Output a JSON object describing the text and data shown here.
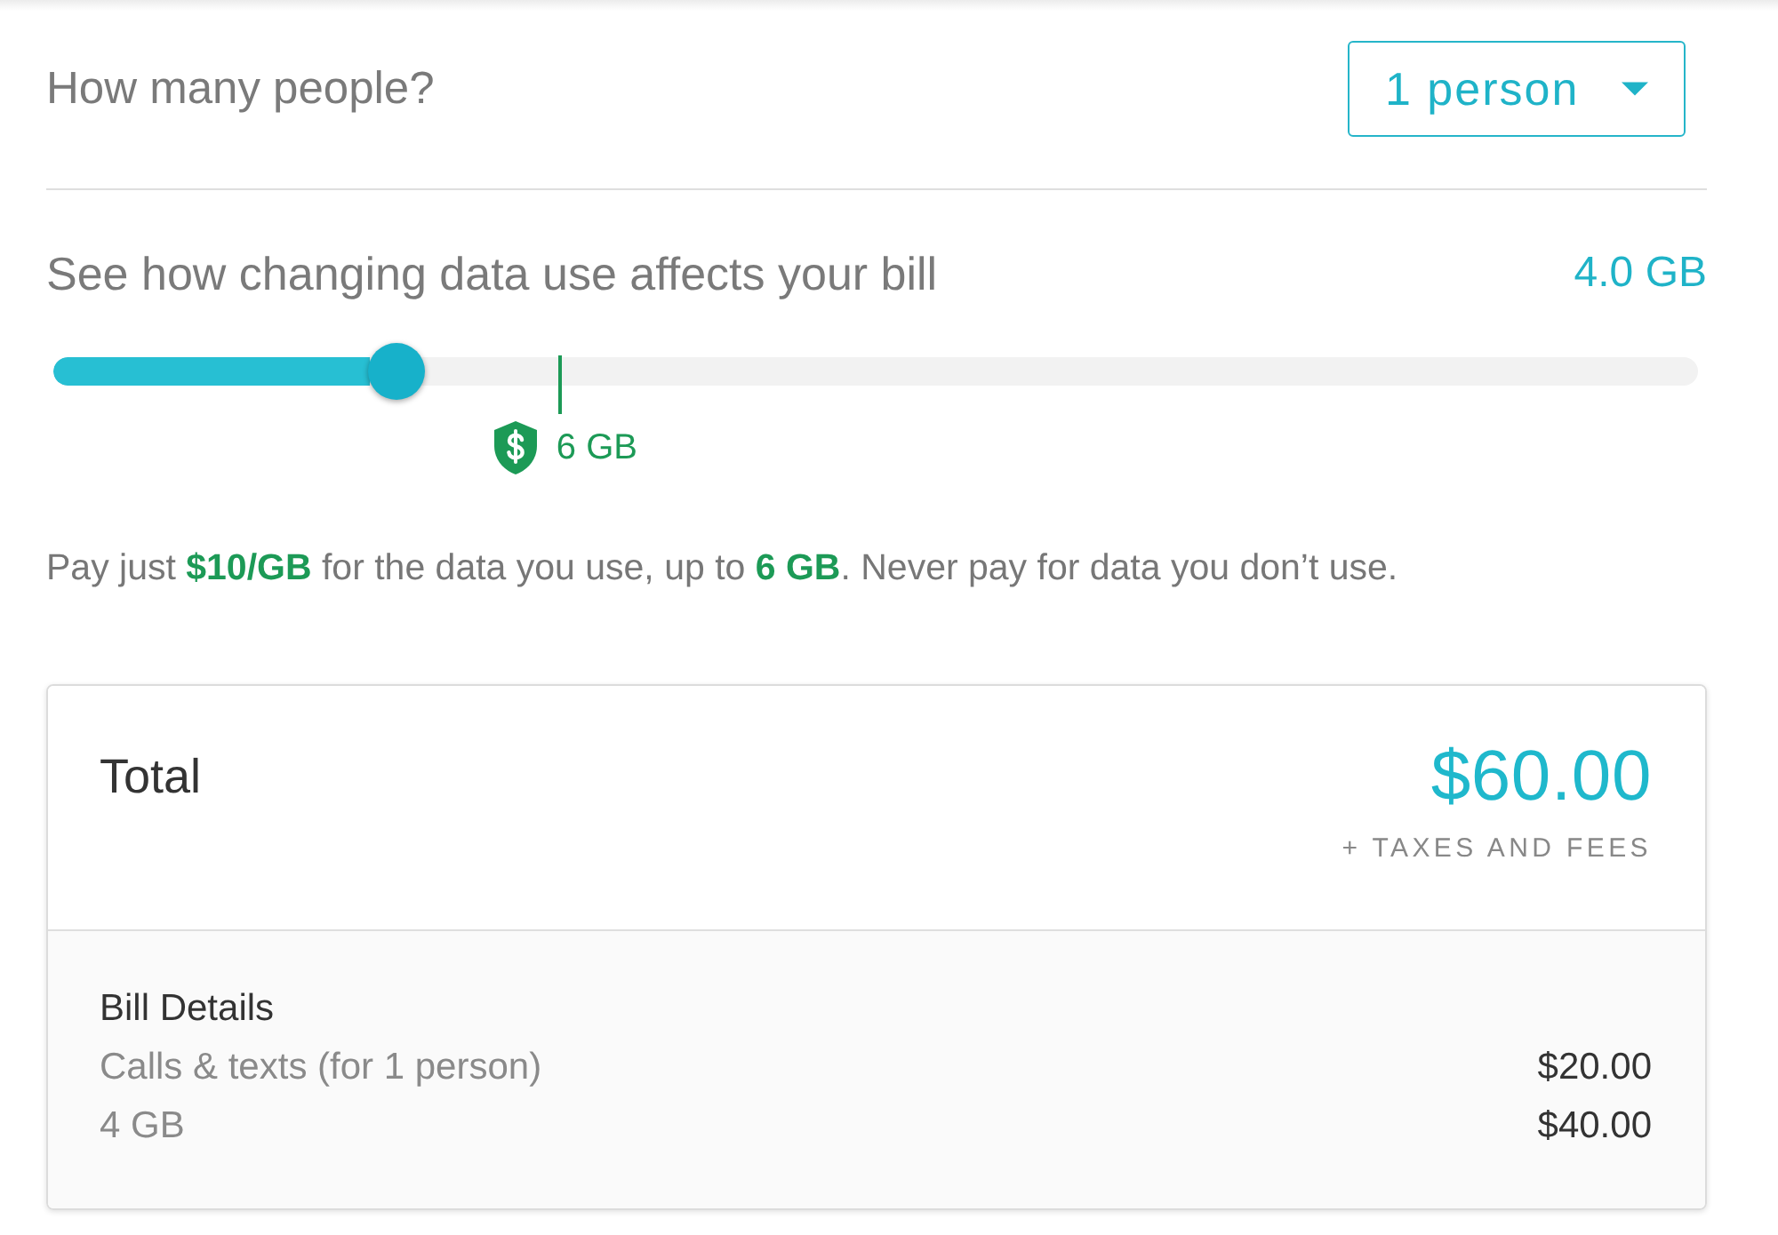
{
  "people": {
    "label": "How many people?",
    "dropdown": {
      "value": "1 person"
    }
  },
  "data_use": {
    "label": "See how changing data use affects your bill",
    "reading": "4.0 GB",
    "slider": {
      "level": 0.209
    },
    "cap_marker": {
      "level": 0.308,
      "label": "6 GB"
    }
  },
  "note": "Pay just **$10/GB** for the data you use, up to **6 GB**. Never pay for data you don’t use.",
  "total_card": {
    "label": "Total",
    "amount": "$60.00",
    "subnote": "+ TAXES AND FEES",
    "details": {
      "title": "Bill Details",
      "lines": [
        {
          "label": "Calls & texts (for 1 person)",
          "amount": "$20.00"
        },
        {
          "label": "4 GB",
          "amount": "$40.00"
        }
      ]
    }
  }
}
